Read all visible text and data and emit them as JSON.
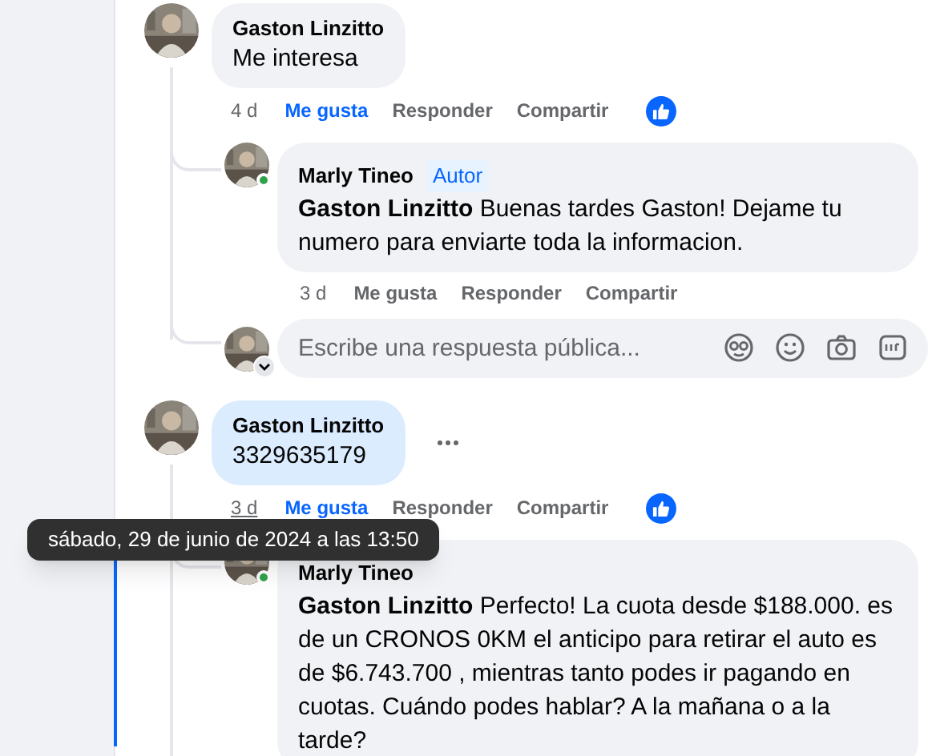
{
  "comments": [
    {
      "author": "Gaston Linzitto",
      "text": "Me interesa",
      "highlighted": false,
      "more_menu": false,
      "time": "4 d",
      "time_hovered": false,
      "liked": true,
      "actions": [
        {
          "label": "Me gusta",
          "selected": true
        },
        {
          "label": "Responder",
          "selected": false
        },
        {
          "label": "Compartir",
          "selected": false
        }
      ],
      "replies": [
        {
          "author": "Marly Tineo",
          "badge": "Autor",
          "online": true,
          "text": "**Gaston Linzitto** Buenas tardes Gaston! Dejame tu numero para enviarte toda la informacion.",
          "time": "3 d",
          "liked": false,
          "actions": [
            {
              "label": "Me gusta",
              "selected": false
            },
            {
              "label": "Responder",
              "selected": false
            },
            {
              "label": "Compartir",
              "selected": false
            }
          ]
        }
      ],
      "reply_box": {
        "placeholder": "Escribe una respuesta pública..."
      }
    },
    {
      "author": "Gaston Linzitto",
      "text": "3329635179",
      "highlighted": true,
      "more_menu": true,
      "time": "3 d",
      "time_hovered": true,
      "liked": true,
      "actions": [
        {
          "label": "Me gusta",
          "selected": true
        },
        {
          "label": "Responder",
          "selected": false
        },
        {
          "label": "Compartir",
          "selected": false
        }
      ],
      "replies": [
        {
          "author": "Marly Tineo",
          "online": true,
          "text": "**Gaston Linzitto** Perfecto! La cuota desde $188.000. es de un CRONOS 0KM el anticipo para retirar el auto es de $6.743.700 , mientras tanto podes ir pagando en cuotas. Cuándo podes hablar? A la mañana o a la tarde?"
        }
      ]
    }
  ],
  "tooltip": {
    "text": "sábado, 29 de junio de 2024 a las 13:50"
  }
}
